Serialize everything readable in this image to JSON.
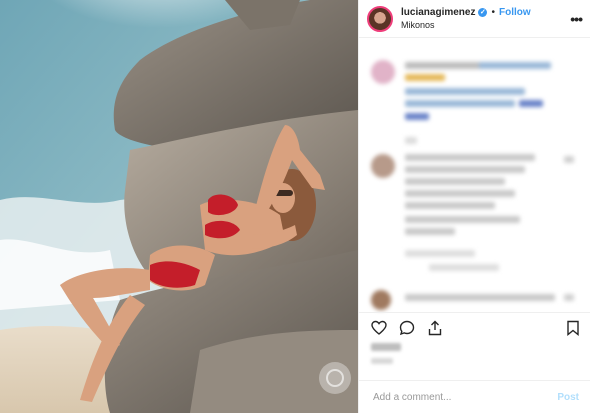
{
  "header": {
    "username": "lucianagimenez",
    "verified_glyph": "✓",
    "separator": "•",
    "follow_label": "Follow",
    "location": "Mikonos",
    "more_glyph": "•••"
  },
  "media": {
    "alt": "Woman in red bikini reclining on sunlit beach rocks by the sea"
  },
  "comment_box": {
    "placeholder": "Add a comment...",
    "post_label": "Post"
  },
  "icons": {
    "like": "heart-icon",
    "comment": "comment-bubble-icon",
    "share": "share-icon",
    "save": "bookmark-icon"
  },
  "colors": {
    "accent": "#3897f0",
    "post_disabled": "#b2dffc",
    "avatar_ring": "#ef3e7b"
  }
}
